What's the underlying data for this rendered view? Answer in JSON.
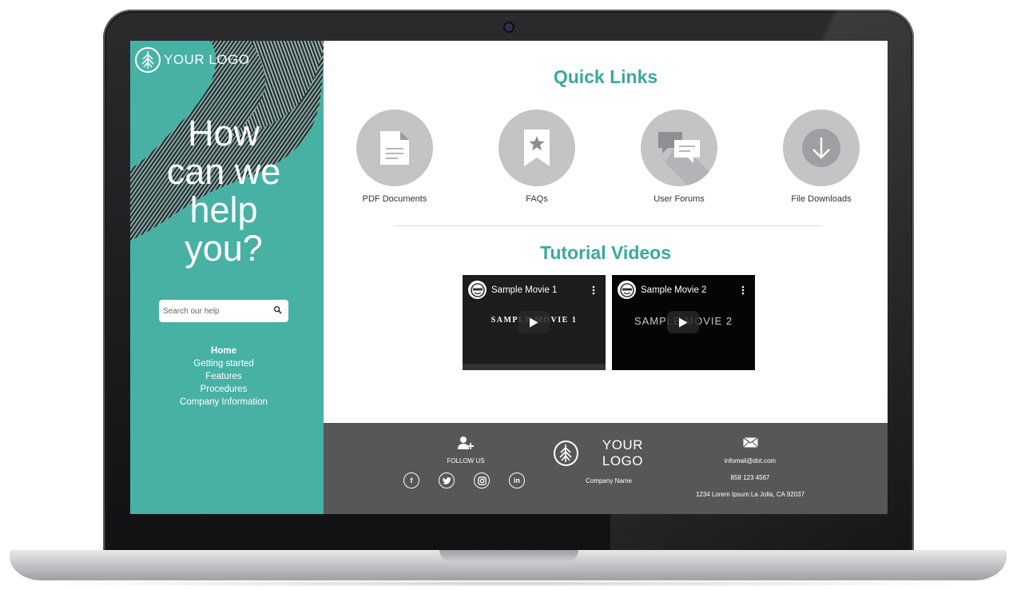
{
  "sidebar": {
    "logo_text": "YOUR LOGO",
    "hero_text": "How\ncan we\nhelp\nyou?",
    "search_placeholder": "Search our help",
    "nav": [
      {
        "label": "Home",
        "active": true
      },
      {
        "label": "Getting started"
      },
      {
        "label": "Features"
      },
      {
        "label": "Procedures"
      },
      {
        "label": "Company Information"
      }
    ]
  },
  "main": {
    "quick_links_title": "Quick Links",
    "quick_links": [
      {
        "label": "PDF Documents",
        "icon": "document-icon"
      },
      {
        "label": "FAQs",
        "icon": "bookmark-star-icon"
      },
      {
        "label": "User Forums",
        "icon": "chat-bubbles-icon"
      },
      {
        "label": "File Downloads",
        "icon": "download-icon"
      }
    ],
    "tutorial_videos_title": "Tutorial Videos",
    "videos": [
      {
        "title": "Sample Movie 1",
        "overlay_text": "SAMPLE MOVIE 1"
      },
      {
        "title": "Sample Movie 2",
        "overlay_text": "SAMPLE MOVIE 2"
      }
    ]
  },
  "footer": {
    "follow_us": "FOLLOW US",
    "logo_text": "YOUR LOGO",
    "company_name": "Company Name",
    "email": "infomail@dot.com",
    "phone": "858 123 4567",
    "address": "1234 Lorem Ipsum La Jolla, CA 92037",
    "social": [
      {
        "glyph": "f",
        "icon": "facebook-icon"
      },
      {
        "glyph": "",
        "icon": "twitter-icon"
      },
      {
        "glyph": "",
        "icon": "instagram-icon"
      },
      {
        "glyph": "in",
        "icon": "linkedin-icon"
      }
    ]
  },
  "colors": {
    "teal": "#47b1a4",
    "title_teal": "#3aa99d",
    "footer_gray": "#575757",
    "circle_gray": "#c3c4c6"
  }
}
